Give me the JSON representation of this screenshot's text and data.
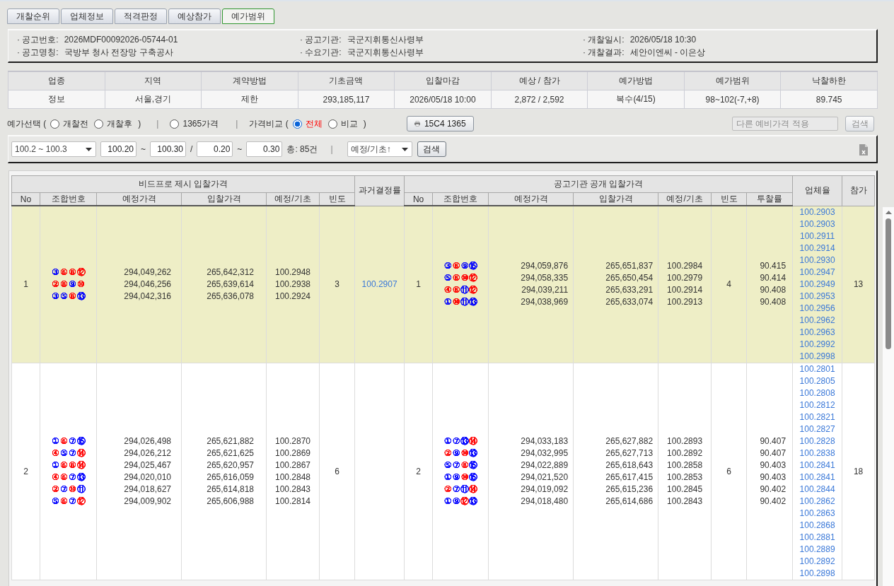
{
  "tabs": [
    {
      "label": "개찰순위",
      "selected": false
    },
    {
      "label": "업체정보",
      "selected": false
    },
    {
      "label": "적격판정",
      "selected": false
    },
    {
      "label": "예상참가",
      "selected": false
    },
    {
      "label": "예가범위",
      "selected": true
    }
  ],
  "notice": [
    {
      "label": "· 공고번호:",
      "value": "2026MDF00092026-05744-01"
    },
    {
      "label": "· 공고기관:",
      "value": "국군지휘통신사령부"
    },
    {
      "label": "· 개찰일시:",
      "value": "2026/05/18 10:30"
    },
    {
      "label": "· 공고명칭:",
      "value": "국방부 청사 전장망 구축공사"
    },
    {
      "label": "· 수요기관:",
      "value": "국군지휘통신사령부"
    },
    {
      "label": "· 개찰결과:",
      "value": "세안이엔씨 - 이은상"
    }
  ],
  "summary": {
    "columns": [
      "업종",
      "지역",
      "계약방법",
      "기초금액",
      "입찰마감",
      "예상 / 참가",
      "예가방법",
      "예가범위",
      "낙찰하한"
    ],
    "values": [
      "정보",
      "서울,경기",
      "제한",
      "293,185,117",
      "2026/05/18 10:00",
      "2,872 / 2,592",
      "복수(4/15)",
      "98~102(-7,+8)",
      "89.745"
    ]
  },
  "filter_bar": [
    {
      "kind": "text",
      "text": "예가선택 ("
    },
    {
      "kind": "radio",
      "label": "개찰전",
      "selected": false
    },
    {
      "kind": "radio",
      "label": "개찰후",
      "selected": false
    },
    {
      "kind": "text",
      "text": ")"
    },
    {
      "kind": "separator",
      "text": "|"
    },
    {
      "kind": "radio",
      "label": "1365가격",
      "selected": false
    },
    {
      "kind": "separator",
      "text": "|"
    },
    {
      "kind": "text",
      "text": "가격비교 ("
    },
    {
      "kind": "radio",
      "label": "전체",
      "selected": true
    },
    {
      "kind": "radio",
      "label": "비교",
      "selected": false
    },
    {
      "kind": "text",
      "text": ")"
    },
    {
      "kind": "print_button",
      "label": "15C4 1365"
    }
  ],
  "other_price": {
    "placeholder": "다른 예비가격 적용",
    "button": "검색",
    "disabled": true
  },
  "range_bar": [
    {
      "kind": "select",
      "value": "100.2 ~ 100.3"
    },
    {
      "kind": "input",
      "value": "100.20"
    },
    {
      "kind": "text",
      "text": "~"
    },
    {
      "kind": "input",
      "value": "100.30"
    },
    {
      "kind": "text",
      "text": "/"
    },
    {
      "kind": "input",
      "value": "0.20"
    },
    {
      "kind": "text",
      "text": "~"
    },
    {
      "kind": "input",
      "value": "0.30"
    },
    {
      "kind": "text",
      "text": "총: 85건"
    },
    {
      "kind": "separator",
      "text": "|"
    },
    {
      "kind": "select",
      "value": "예정/기초↑"
    },
    {
      "kind": "button",
      "label": "검색"
    }
  ],
  "table": {
    "groups": [
      {
        "label": "비드프로 제시 입찰가격",
        "columns": [
          "No",
          "조합번호",
          "예정가격",
          "입찰가격",
          "예정/기초",
          "빈도"
        ]
      },
      {
        "label": "과거결정률"
      },
      {
        "label": "공고기관 공개 입찰가격",
        "columns": [
          "No",
          "조합번호",
          "예정가격",
          "입찰가격",
          "예정/기초",
          "빈도",
          "투찰률"
        ]
      },
      {
        "label": "업체율"
      },
      {
        "label": "참가"
      }
    ],
    "rows": [
      {
        "selected": true,
        "bidpro": {
          "no": "1",
          "frequency": "3",
          "entries": [
            {
              "balls": [
                {
                  "n": "③",
                  "color": "#0000ff"
                },
                {
                  "n": "⑥",
                  "color": "#ff0000"
                },
                {
                  "n": "⑧",
                  "color": "#ff0000"
                },
                {
                  "n": "⑫",
                  "color": "#ff0000"
                }
              ],
              "estimate": "294,049,262",
              "bid": "265,642,312",
              "ratio": "100.2948"
            },
            {
              "balls": [
                {
                  "n": "②",
                  "color": "#ff0000"
                },
                {
                  "n": "⑧",
                  "color": "#ff0000"
                },
                {
                  "n": "⑨",
                  "color": "#0000ff"
                },
                {
                  "n": "⑩",
                  "color": "#ff0000"
                }
              ],
              "estimate": "294,046,256",
              "bid": "265,639,614",
              "ratio": "100.2938"
            },
            {
              "balls": [
                {
                  "n": "③",
                  "color": "#0000ff"
                },
                {
                  "n": "⑤",
                  "color": "#0000ff"
                },
                {
                  "n": "⑧",
                  "color": "#ff0000"
                },
                {
                  "n": "⑬",
                  "color": "#0000ff"
                }
              ],
              "estimate": "294,042,316",
              "bid": "265,636,078",
              "ratio": "100.2924"
            }
          ]
        },
        "past_rate": "100.2907",
        "agency": {
          "no": "1",
          "frequency": "4",
          "entries": [
            {
              "balls": [
                {
                  "n": "③",
                  "color": "#0000ff"
                },
                {
                  "n": "⑧",
                  "color": "#ff0000"
                },
                {
                  "n": "⑨",
                  "color": "#0000ff"
                },
                {
                  "n": "⑮",
                  "color": "#0000ff"
                }
              ],
              "estimate": "294,059,876",
              "bid": "265,651,837",
              "ratio": "100.2984",
              "rate": "90.415"
            },
            {
              "balls": [
                {
                  "n": "⑤",
                  "color": "#0000ff"
                },
                {
                  "n": "⑧",
                  "color": "#ff0000"
                },
                {
                  "n": "⑩",
                  "color": "#ff0000"
                },
                {
                  "n": "⑫",
                  "color": "#ff0000"
                }
              ],
              "estimate": "294,058,335",
              "bid": "265,650,454",
              "ratio": "100.2979",
              "rate": "90.414"
            },
            {
              "balls": [
                {
                  "n": "④",
                  "color": "#ff0000"
                },
                {
                  "n": "⑧",
                  "color": "#ff0000"
                },
                {
                  "n": "⑪",
                  "color": "#0000ff"
                },
                {
                  "n": "⑫",
                  "color": "#ff0000"
                }
              ],
              "estimate": "294,039,211",
              "bid": "265,633,291",
              "ratio": "100.2914",
              "rate": "90.408"
            },
            {
              "balls": [
                {
                  "n": "①",
                  "color": "#0000ff"
                },
                {
                  "n": "⑩",
                  "color": "#ff0000"
                },
                {
                  "n": "⑪",
                  "color": "#0000ff"
                },
                {
                  "n": "⑬",
                  "color": "#0000ff"
                }
              ],
              "estimate": "294,038,969",
              "bid": "265,633,074",
              "ratio": "100.2913",
              "rate": "90.408"
            }
          ]
        },
        "company_rates": [
          "100.2903",
          "100.2903",
          "100.2911",
          "100.2914",
          "100.2930",
          "100.2947",
          "100.2949",
          "100.2953",
          "100.2956",
          "100.2962",
          "100.2963",
          "100.2992",
          "100.2998"
        ],
        "participants": "13"
      },
      {
        "selected": false,
        "bidpro": {
          "no": "2",
          "frequency": "6",
          "entries": [
            {
              "balls": [
                {
                  "n": "①",
                  "color": "#0000ff"
                },
                {
                  "n": "⑥",
                  "color": "#ff0000"
                },
                {
                  "n": "⑦",
                  "color": "#0000ff"
                },
                {
                  "n": "⑮",
                  "color": "#0000ff"
                }
              ],
              "estimate": "294,026,498",
              "bid": "265,621,882",
              "ratio": "100.2870"
            },
            {
              "balls": [
                {
                  "n": "④",
                  "color": "#ff0000"
                },
                {
                  "n": "⑤",
                  "color": "#0000ff"
                },
                {
                  "n": "⑦",
                  "color": "#0000ff"
                },
                {
                  "n": "⑭",
                  "color": "#ff0000"
                }
              ],
              "estimate": "294,026,212",
              "bid": "265,621,625",
              "ratio": "100.2869"
            },
            {
              "balls": [
                {
                  "n": "①",
                  "color": "#0000ff"
                },
                {
                  "n": "⑥",
                  "color": "#ff0000"
                },
                {
                  "n": "⑧",
                  "color": "#ff0000"
                },
                {
                  "n": "⑭",
                  "color": "#ff0000"
                }
              ],
              "estimate": "294,025,467",
              "bid": "265,620,957",
              "ratio": "100.2867"
            },
            {
              "balls": [
                {
                  "n": "④",
                  "color": "#ff0000"
                },
                {
                  "n": "⑥",
                  "color": "#ff0000"
                },
                {
                  "n": "⑦",
                  "color": "#0000ff"
                },
                {
                  "n": "⑬",
                  "color": "#0000ff"
                }
              ],
              "estimate": "294,020,010",
              "bid": "265,616,059",
              "ratio": "100.2848"
            },
            {
              "balls": [
                {
                  "n": "②",
                  "color": "#ff0000"
                },
                {
                  "n": "⑦",
                  "color": "#0000ff"
                },
                {
                  "n": "⑩",
                  "color": "#ff0000"
                },
                {
                  "n": "⑪",
                  "color": "#0000ff"
                }
              ],
              "estimate": "294,018,627",
              "bid": "265,614,818",
              "ratio": "100.2843"
            },
            {
              "balls": [
                {
                  "n": "⑤",
                  "color": "#0000ff"
                },
                {
                  "n": "⑥",
                  "color": "#ff0000"
                },
                {
                  "n": "⑦",
                  "color": "#0000ff"
                },
                {
                  "n": "⑫",
                  "color": "#ff0000"
                }
              ],
              "estimate": "294,009,902",
              "bid": "265,606,988",
              "ratio": "100.2814"
            }
          ]
        },
        "agency": {
          "no": "2",
          "frequency": "6",
          "entries": [
            {
              "balls": [
                {
                  "n": "①",
                  "color": "#0000ff"
                },
                {
                  "n": "⑦",
                  "color": "#0000ff"
                },
                {
                  "n": "⑬",
                  "color": "#0000ff"
                },
                {
                  "n": "⑭",
                  "color": "#ff0000"
                }
              ],
              "estimate": "294,033,183",
              "bid": "265,627,882",
              "ratio": "100.2893",
              "rate": "90.407"
            },
            {
              "balls": [
                {
                  "n": "②",
                  "color": "#ff0000"
                },
                {
                  "n": "⑨",
                  "color": "#0000ff"
                },
                {
                  "n": "⑩",
                  "color": "#ff0000"
                },
                {
                  "n": "⑬",
                  "color": "#0000ff"
                }
              ],
              "estimate": "294,032,995",
              "bid": "265,627,713",
              "ratio": "100.2892",
              "rate": "90.407"
            },
            {
              "balls": [
                {
                  "n": "⑤",
                  "color": "#0000ff"
                },
                {
                  "n": "⑦",
                  "color": "#0000ff"
                },
                {
                  "n": "⑧",
                  "color": "#ff0000"
                },
                {
                  "n": "⑮",
                  "color": "#0000ff"
                }
              ],
              "estimate": "294,022,889",
              "bid": "265,618,643",
              "ratio": "100.2858",
              "rate": "90.403"
            },
            {
              "balls": [
                {
                  "n": "①",
                  "color": "#0000ff"
                },
                {
                  "n": "⑨",
                  "color": "#0000ff"
                },
                {
                  "n": "⑩",
                  "color": "#ff0000"
                },
                {
                  "n": "⑮",
                  "color": "#0000ff"
                }
              ],
              "estimate": "294,021,520",
              "bid": "265,617,415",
              "ratio": "100.2853",
              "rate": "90.403"
            },
            {
              "balls": [
                {
                  "n": "②",
                  "color": "#ff0000"
                },
                {
                  "n": "⑦",
                  "color": "#0000ff"
                },
                {
                  "n": "⑪",
                  "color": "#0000ff"
                },
                {
                  "n": "⑭",
                  "color": "#ff0000"
                }
              ],
              "estimate": "294,019,092",
              "bid": "265,615,236",
              "ratio": "100.2845",
              "rate": "90.402"
            },
            {
              "balls": [
                {
                  "n": "①",
                  "color": "#0000ff"
                },
                {
                  "n": "⑨",
                  "color": "#0000ff"
                },
                {
                  "n": "⑫",
                  "color": "#ff0000"
                },
                {
                  "n": "⑬",
                  "color": "#0000ff"
                }
              ],
              "estimate": "294,018,480",
              "bid": "265,614,686",
              "ratio": "100.2843",
              "rate": "90.402"
            }
          ]
        },
        "company_rates": [
          "100.2801",
          "100.2805",
          "100.2808",
          "100.2812",
          "100.2821",
          "100.2827",
          "100.2828",
          "100.2838",
          "100.2841",
          "100.2841",
          "100.2844",
          "100.2862",
          "100.2863",
          "100.2868",
          "100.2881",
          "100.2889",
          "100.2892",
          "100.2898"
        ],
        "participants": "18"
      }
    ]
  }
}
